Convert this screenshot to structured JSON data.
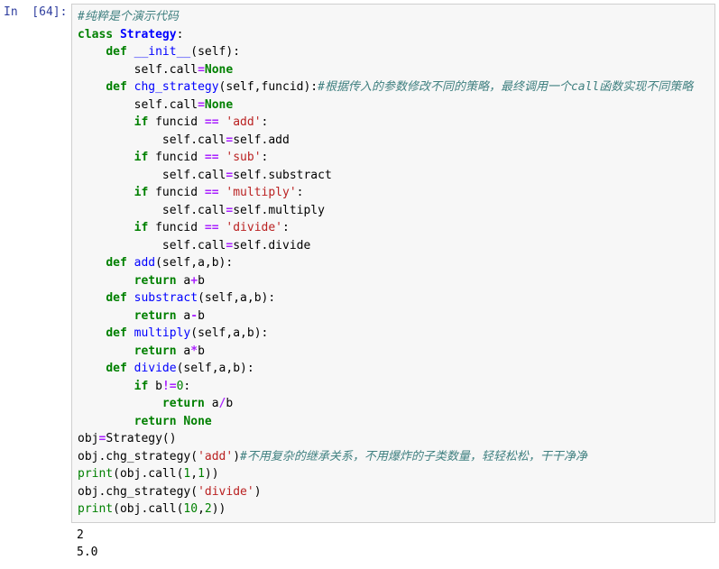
{
  "prompt": {
    "in_label": "In  [64]:",
    "out_label": ""
  },
  "code": {
    "l01_comment": "#纯粹是个演示代码",
    "l02_class": "class",
    "l02_name": "Strategy",
    "l03_def": "def",
    "l03_name": "__init__",
    "l03_self": "(self):",
    "l04_body": "        self.call",
    "l04_eq": "=",
    "l04_none": "None",
    "l05_def": "def",
    "l05_name": "chg_strategy",
    "l05_args": "(self,funcid):",
    "l05_comment": "#根据传入的参数修改不同的策略，最终调用一个call函数实现不同策略",
    "l06_body": "        self.call",
    "l06_eq": "=",
    "l06_none": "None",
    "l07_if": "if",
    "l07_var": " funcid ",
    "l07_eq": "==",
    "l07_str": " 'add'",
    "l08_body": "            self.call",
    "l08_eq": "=",
    "l08_rest": "self.add",
    "l09_if": "if",
    "l09_var": " funcid ",
    "l09_eq": "==",
    "l09_str": " 'sub'",
    "l10_body": "            self.call",
    "l10_eq": "=",
    "l10_rest": "self.substract",
    "l11_if": "if",
    "l11_var": " funcid ",
    "l11_eq": "==",
    "l11_str": " 'multiply'",
    "l12_body": "            self.call",
    "l12_eq": "=",
    "l12_rest": "self.multiply",
    "l13_if": "if",
    "l13_var": " funcid ",
    "l13_eq": "==",
    "l13_str": " 'divide'",
    "l14_body": "            self.call",
    "l14_eq": "=",
    "l14_rest": "self.divide",
    "l15_def": "def",
    "l15_name": "add",
    "l15_args": "(self,a,b):",
    "l16_ret": "return",
    "l16_expr_a": " a",
    "l16_op": "+",
    "l16_expr_b": "b",
    "l17_def": "def",
    "l17_name": "substract",
    "l17_args": "(self,a,b):",
    "l18_ret": "return",
    "l18_expr_a": " a",
    "l18_op": "-",
    "l18_expr_b": "b",
    "l19_def": "def",
    "l19_name": "multiply",
    "l19_args": "(self,a,b):",
    "l20_ret": "return",
    "l20_expr_a": " a",
    "l20_op": "*",
    "l20_expr_b": "b",
    "l21_def": "def",
    "l21_name": "divide",
    "l21_args": "(self,a,b):",
    "l22_if": "if",
    "l22_var": " b",
    "l22_op": "!=",
    "l22_num": "0",
    "l23_ret": "return",
    "l23_expr_a": " a",
    "l23_op": "/",
    "l23_expr_b": "b",
    "l24_ret": "return",
    "l24_none": "None",
    "l25_obj": "obj",
    "l25_eq": "=",
    "l25_rest": "Strategy()",
    "l26_call": "obj.chg_strategy(",
    "l26_str": "'add'",
    "l26_close": ")",
    "l26_comment": "#不用复杂的继承关系，不用爆炸的子类数量，轻轻松松，干干净净",
    "l27_print": "print",
    "l27_open": "(obj.call(",
    "l27_n1": "1",
    "l27_c": ",",
    "l27_n2": "1",
    "l27_close": "))",
    "l28_call": "obj.chg_strategy(",
    "l28_str": "'divide'",
    "l28_close": ")",
    "l29_print": "print",
    "l29_open": "(obj.call(",
    "l29_n1": "10",
    "l29_c": ",",
    "l29_n2": "2",
    "l29_close": "))"
  },
  "output": {
    "line1": "2",
    "line2": "5.0"
  }
}
